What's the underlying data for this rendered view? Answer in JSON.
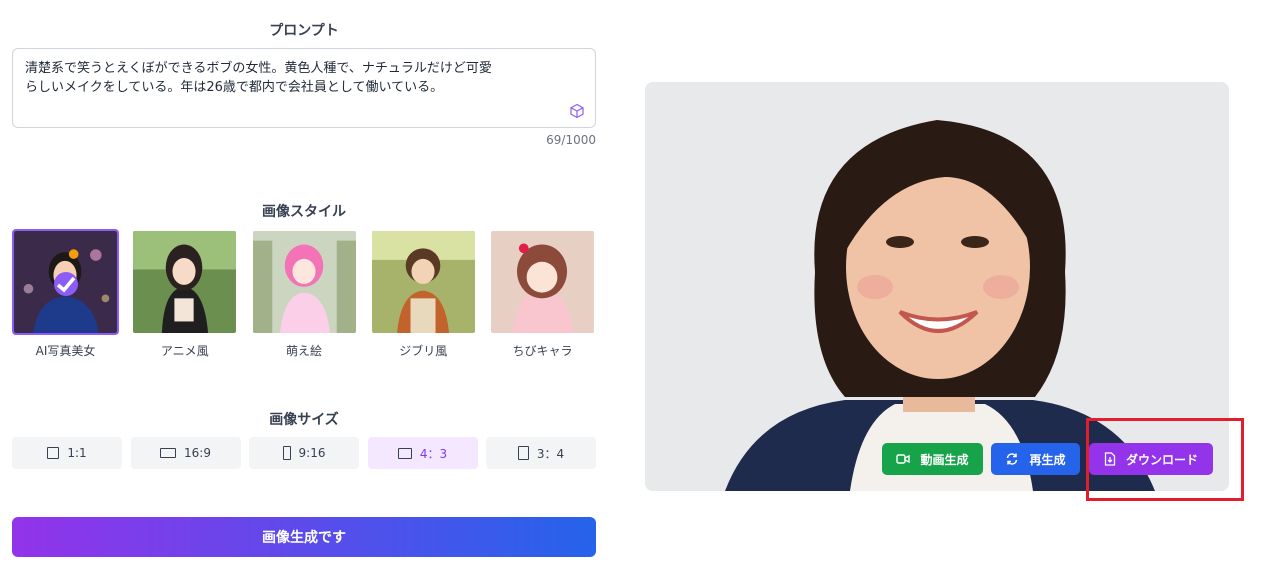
{
  "prompt": {
    "title": "プロンプト",
    "text_line1": "清楚系で笑うとえくぼができるボブの女性。黄色人種で、ナチュラルだけど可愛",
    "text_line2": "らしいメイクをしている。年は26歳で都内で会社員として働いている。",
    "counter": "69/1000"
  },
  "style_section": {
    "title": "画像スタイル",
    "items": [
      {
        "label": "AI写真美女",
        "selected": true
      },
      {
        "label": "アニメ風",
        "selected": false
      },
      {
        "label": "萌え絵",
        "selected": false
      },
      {
        "label": "ジブリ風",
        "selected": false
      },
      {
        "label": "ちびキャラ",
        "selected": false
      }
    ]
  },
  "size_section": {
    "title": "画像サイズ",
    "items": [
      {
        "label": "1:1",
        "active": false
      },
      {
        "label": "16:9",
        "active": false
      },
      {
        "label": "9:16",
        "active": false
      },
      {
        "label": "4：3",
        "active": true
      },
      {
        "label": "3：4",
        "active": false
      }
    ]
  },
  "generate_label": "画像生成です",
  "actions": {
    "video": "動画生成",
    "regenerate": "再生成",
    "download": "ダウンロード"
  },
  "colors": {
    "accent_purple": "#8b5cf6",
    "video_green": "#16a34a",
    "regen_blue": "#2563eb",
    "download_purple": "#9333ea",
    "highlight_red": "#e11d2e"
  }
}
